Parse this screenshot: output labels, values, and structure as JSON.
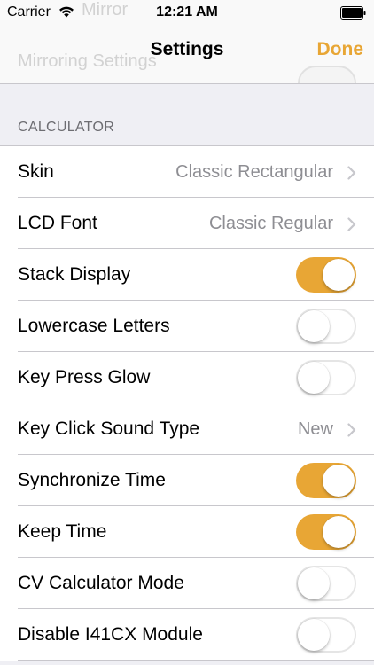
{
  "status_bar": {
    "carrier": "Carrier",
    "time": "12:21 AM"
  },
  "nav": {
    "title": "Settings",
    "done_label": "Done"
  },
  "background_rows": {
    "top_text": "Mirror",
    "bottom_text": "Mirroring Settings"
  },
  "section": {
    "header": "CALCULATOR"
  },
  "rows": [
    {
      "label": "Skin",
      "value": "Classic Rectangular",
      "kind": "disclosure"
    },
    {
      "label": "LCD Font",
      "value": "Classic Regular",
      "kind": "disclosure"
    },
    {
      "label": "Stack Display",
      "kind": "toggle",
      "on": true
    },
    {
      "label": "Lowercase Letters",
      "kind": "toggle",
      "on": false
    },
    {
      "label": "Key Press Glow",
      "kind": "toggle",
      "on": false
    },
    {
      "label": "Key Click Sound Type",
      "value": "New",
      "kind": "disclosure"
    },
    {
      "label": "Synchronize Time",
      "kind": "toggle",
      "on": true
    },
    {
      "label": "Keep Time",
      "kind": "toggle",
      "on": true
    },
    {
      "label": "CV Calculator Mode",
      "kind": "toggle",
      "on": false
    },
    {
      "label": "Disable I41CX Module",
      "kind": "toggle",
      "on": false
    }
  ],
  "colors": {
    "accent": "#e8a635",
    "value_gray": "#8e8e93",
    "section_gray": "#6d6d72",
    "group_background": "#efeff4"
  },
  "icons": {
    "status": [
      "wifi-icon",
      "battery-icon"
    ],
    "disclosure": "chevron-right-icon"
  }
}
